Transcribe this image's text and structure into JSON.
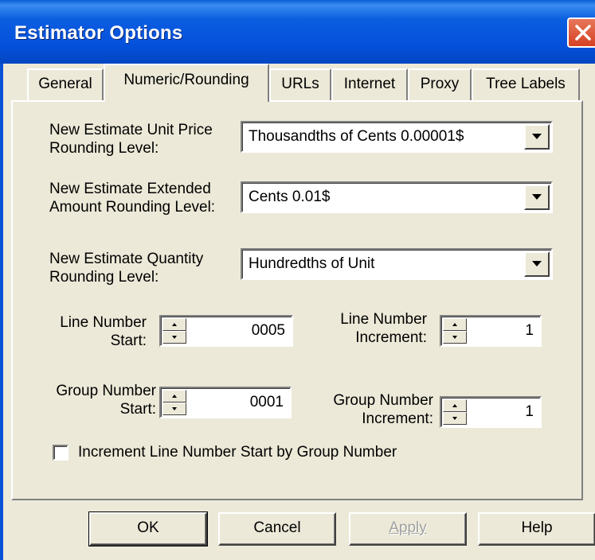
{
  "window": {
    "title": "Estimator Options"
  },
  "tabs": [
    {
      "label": "General"
    },
    {
      "label": "Numeric/Rounding",
      "active": true
    },
    {
      "label": "URLs"
    },
    {
      "label": "Internet"
    },
    {
      "label": "Proxy"
    },
    {
      "label": "Tree Labels"
    }
  ],
  "fields": {
    "unit_price": {
      "label_line1": "New Estimate Unit Price",
      "label_line2": "Rounding Level:",
      "value": "Thousandths of Cents 0.00001$"
    },
    "extended_amount": {
      "label_line1": "New Estimate Extended",
      "label_line2": "Amount Rounding Level:",
      "value": "Cents 0.01$"
    },
    "quantity": {
      "label_line1": "New Estimate Quantity",
      "label_line2": "Rounding Level:",
      "value": "Hundredths of Unit"
    },
    "line_start": {
      "label_line1": "Line Number",
      "label_line2": "Start:",
      "value": "0005"
    },
    "line_increment": {
      "label_line1": "Line Number",
      "label_line2": "Increment:",
      "value": "1"
    },
    "group_start": {
      "label_line1": "Group Number",
      "label_line2": "Start:",
      "value": "0001"
    },
    "group_increment": {
      "label_line1": "Group Number",
      "label_line2": "Increment:",
      "value": "1"
    }
  },
  "checkbox": {
    "label": "Increment Line Number Start by Group Number",
    "checked": false
  },
  "buttons": {
    "ok": "OK",
    "cancel": "Cancel",
    "apply": "Apply",
    "help": "Help"
  },
  "icons": {
    "close": "close-icon",
    "dropdown": "chevron-down-icon",
    "spin_up": "spin-up-icon",
    "spin_down": "spin-down-icon"
  },
  "colors": {
    "titlebar": "#0551dc",
    "face": "#ece9d8",
    "close": "#d54023"
  }
}
